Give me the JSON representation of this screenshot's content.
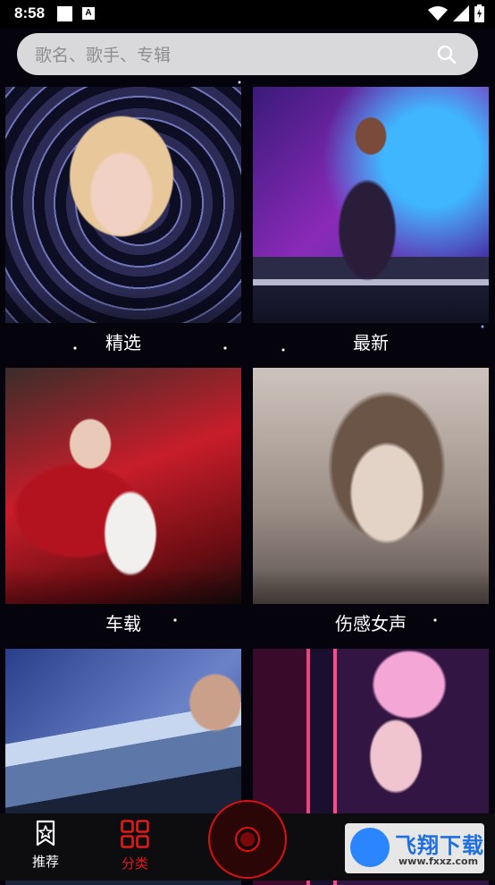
{
  "status_bar": {
    "time": "8:58",
    "icons": [
      "notification-square-icon",
      "notification-a-icon",
      "wifi-icon",
      "signal-icon",
      "battery-icon"
    ]
  },
  "search": {
    "placeholder": "歌名、歌手、专辑",
    "icon": "search-icon"
  },
  "categories": [
    {
      "label": "精选"
    },
    {
      "label": "最新"
    },
    {
      "label": "车载"
    },
    {
      "label": "伤感女声"
    },
    {
      "label": ""
    },
    {
      "label": ""
    }
  ],
  "bottom_nav": {
    "items": [
      {
        "label": "推荐",
        "icon": "star-bookmark-icon",
        "active": false
      },
      {
        "label": "分类",
        "icon": "grid-icon",
        "active": true
      }
    ],
    "accent_color": "#e21a1a",
    "center_button_icon": "vinyl-record-icon"
  },
  "watermark": {
    "brand": "飞翔下载",
    "url": "www.fxxz.com"
  }
}
